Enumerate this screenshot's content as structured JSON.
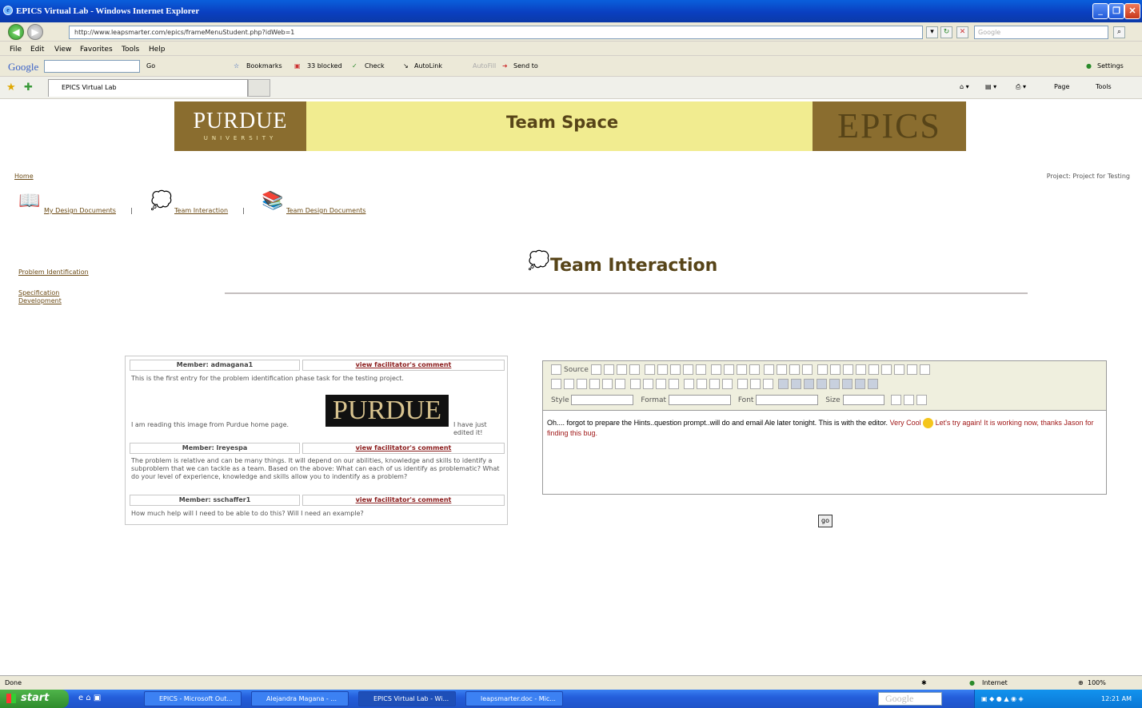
{
  "window": {
    "title": "EPICS Virtual Lab - Windows Internet Explorer"
  },
  "address": {
    "url": "http://www.leapsmarter.com/epics/frameMenuStudent.php?idWeb=1",
    "search_placeholder": "Google"
  },
  "menu": [
    "File",
    "Edit",
    "View",
    "Favorites",
    "Tools",
    "Help"
  ],
  "gbar": {
    "logo": "Google",
    "go": "Go",
    "bookmarks": "Bookmarks",
    "blocked": "33 blocked",
    "check": "Check",
    "autolink": "AutoLink",
    "autofill": "AutoFill",
    "sendto": "Send to",
    "settings": "Settings"
  },
  "tab": {
    "label": "EPICS Virtual Lab"
  },
  "cmd": {
    "page": "Page",
    "tools": "Tools"
  },
  "banner": {
    "purdue": "PURDUE",
    "university": "UNIVERSITY",
    "title": "Team Space",
    "epics": "EPICS"
  },
  "nav": {
    "home": "Home",
    "project": "Project: Project for Testing",
    "my_docs": "My Design Documents",
    "team_interaction": "Team Interaction",
    "team_docs": "Team Design Documents",
    "sep": "|"
  },
  "side": {
    "problem": "Problem Identification",
    "spec1": "Specification",
    "spec2": "Development"
  },
  "page": {
    "title": "Team Interaction"
  },
  "comments": [
    {
      "member": "Member: admagana1",
      "link": "view facilitator's comment",
      "text1": "This is the first entry for the problem identification phase task for the testing project.",
      "text2": "I am reading this image from Purdue home page.",
      "text3": "I have just edited it!",
      "image": "PURDUE"
    },
    {
      "member": "Member: lreyespa",
      "link": "view facilitator's comment",
      "text": "The problem is relative and can be many things. It will depend on our abilities, knowledge and skills to identify a subproblem that we can tackle as a team. Based on the above: What can each of us identify as problematic? What do your level of experience, knowledge and skills allow you to indentify as a problem?"
    },
    {
      "member": "Member: sschaffer1",
      "link": "view facilitator's comment",
      "text": "How much help will I need to be able to do this? Will I need an example?"
    }
  ],
  "editor": {
    "source": "Source",
    "style": "Style",
    "format": "Format",
    "font": "Font",
    "size": "Size",
    "text_black": "Oh.... forgot to prepare the Hints..question prompt..will do and email Ale later tonight.  This is with the editor.",
    "text_red1": "Very Cool",
    "text_red2": "Let's try again!  It is working now, thanks Jason for finding this bug."
  },
  "go_button": "go",
  "status": {
    "done": "Done",
    "zone": "Internet",
    "zoom": "100%"
  },
  "taskbar": {
    "start": "start",
    "tasks": [
      "EPICS - Microsoft Out...",
      "Alejandra Magana - ...",
      "EPICS Virtual Lab - Wi...",
      "leapsmarter.doc - Mic..."
    ],
    "google": "Google",
    "clock": "12:21 AM"
  }
}
